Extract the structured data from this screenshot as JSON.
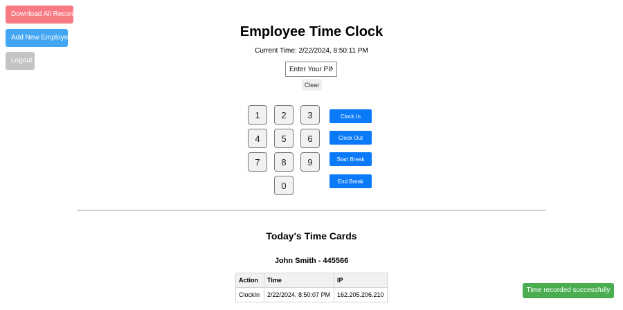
{
  "admin": {
    "download_label": "Download All Records",
    "add_employee_label": "Add New Employee",
    "logout_label": "Logout",
    "colors": {
      "download": "#f87b84",
      "add_employee": "#43a6f3",
      "logout": "#c4c4c4"
    }
  },
  "header": {
    "title": "Employee Time Clock",
    "current_time": "Current Time: 2/22/2024, 8:50:11 PM"
  },
  "pin": {
    "placeholder": "Enter Your PIN:",
    "value": "",
    "clear_label": "Clear"
  },
  "keypad": {
    "keys": [
      "1",
      "2",
      "3",
      "4",
      "5",
      "6",
      "7",
      "8",
      "9",
      "0"
    ]
  },
  "actions": {
    "clock_in": "Clock In",
    "clock_out": "Clock Out",
    "start_break": "Start Break",
    "end_break": "End Break",
    "color": "#0a7af8"
  },
  "timecards": {
    "title": "Today's Time Cards",
    "employee": "John Smith - 445566",
    "columns": [
      "Action",
      "Time",
      "IP"
    ],
    "rows": [
      [
        "ClockIn",
        "2/22/2024, 8:50:07 PM",
        "162.205.206.210"
      ]
    ]
  },
  "toast": {
    "message": "Time recorded successfully",
    "color": "#4aae50"
  }
}
